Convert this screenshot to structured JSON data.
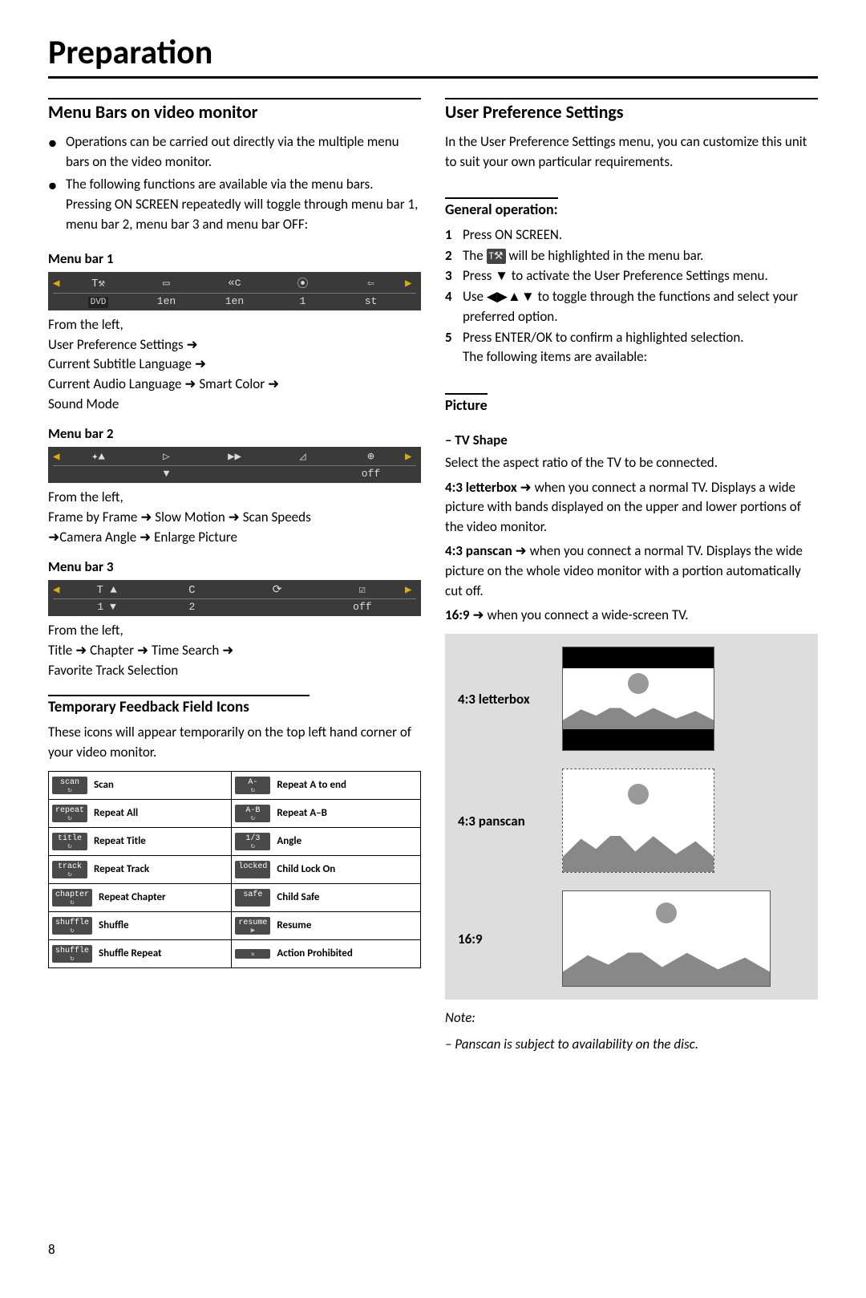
{
  "page_title": "Preparation",
  "page_number": "8",
  "left": {
    "section_a": {
      "heading": "Menu Bars on video monitor",
      "bullets": [
        "Operations can be carried out directly via the multiple menu bars on the video monitor.",
        "The following functions are available via the menu bars. Pressing ON SCREEN repeatedly will toggle through menu bar 1, menu bar 2, menu bar 3 and menu bar OFF:"
      ],
      "menu1": {
        "label": "Menu bar 1",
        "osd_top": [
          "T⚒",
          "▭",
          "«ᴄ",
          "⦿",
          "⇦"
        ],
        "osd_bot": [
          "DVD",
          "1en",
          "1en",
          "1",
          "st"
        ],
        "from": "From the left,",
        "lines": [
          "User Preference Settings ➜",
          "Current Subtitle Language ➜",
          "Current Audio Language ➜ Smart Color ➜",
          "Sound Mode"
        ]
      },
      "menu2": {
        "label": "Menu bar 2",
        "osd_top": [
          "✦▲",
          "▷",
          "▶▶",
          "◿",
          "⊕"
        ],
        "osd_bot": [
          "",
          "▼",
          "",
          "",
          "off"
        ],
        "from": "From the left,",
        "lines": [
          "Frame by Frame ➜ Slow Motion ➜ Scan Speeds",
          "➜Camera Angle ➜ Enlarge Picture"
        ]
      },
      "menu3": {
        "label": "Menu bar 3",
        "osd_top": [
          "T ▲",
          "C",
          "⟳",
          "☑"
        ],
        "osd_bot": [
          "1 ▼",
          "2",
          "",
          "off"
        ],
        "from": "From the left,",
        "lines": [
          "Title ➜ Chapter ➜ Time Search ➜",
          "Favorite Track Selection"
        ]
      }
    },
    "section_b": {
      "heading": "Temporary Feedback Field Icons",
      "intro": "These icons will appear temporarily on the top left hand corner of your video monitor.",
      "rows": [
        [
          {
            "icon": "scan",
            "label": "Scan"
          },
          {
            "icon": "A-",
            "label": "Repeat A to end"
          }
        ],
        [
          {
            "icon": "repeat",
            "label": "Repeat All"
          },
          {
            "icon": "A-B",
            "label": "Repeat A–B"
          }
        ],
        [
          {
            "icon": "title",
            "label": "Repeat Title"
          },
          {
            "icon": "1/3",
            "label": "Angle"
          }
        ],
        [
          {
            "icon": "track",
            "label": "Repeat Track"
          },
          {
            "icon": "locked",
            "label": "Child Lock On"
          }
        ],
        [
          {
            "icon": "chapter",
            "label": "Repeat Chapter"
          },
          {
            "icon": "safe",
            "label": "Child Safe"
          }
        ],
        [
          {
            "icon": "shuffle",
            "label": "Shuffle"
          },
          {
            "icon": "resume",
            "label": "Resume"
          }
        ],
        [
          {
            "icon": "shuffle",
            "label": "Shuffle Repeat"
          },
          {
            "icon": "",
            "label": "Action Prohibited"
          }
        ]
      ]
    }
  },
  "right": {
    "heading": "User Preference Settings",
    "intro": "In the User Preference Settings menu, you can customize this unit to suit your own particular requirements.",
    "general": {
      "heading": "General operation:",
      "steps": [
        "Press ON SCREEN.",
        "The ⚒ will be highlighted in the menu bar.",
        "Press ▼ to activate the User Preference Settings menu.",
        "Use ◀▶▲▼ to toggle through the functions and select your preferred option.",
        "Press ENTER/OK to confirm a highlighted selection."
      ],
      "tail": "The following items are available:"
    },
    "picture": {
      "heading": "Picture",
      "tv_shape_label": "–  TV Shape",
      "tv_shape_intro": "Select the aspect ratio of the TV to be connected.",
      "opts": [
        {
          "name": "4:3 letterbox",
          "desc": " ➜ when you connect a normal TV. Displays a wide picture with bands displayed on the upper and lower portions of the video monitor."
        },
        {
          "name": "4:3 panscan",
          "desc": " ➜ when you connect a normal TV. Displays the wide picture on the whole video monitor with a portion automatically cut off."
        },
        {
          "name": "16:9",
          "desc": " ➜ when you connect a wide-screen TV."
        }
      ],
      "panel_labels": [
        "4:3 letterbox",
        "4:3 panscan",
        "16:9"
      ],
      "note_head": "Note:",
      "note_body": "–  Panscan is subject to availability on the disc."
    }
  }
}
